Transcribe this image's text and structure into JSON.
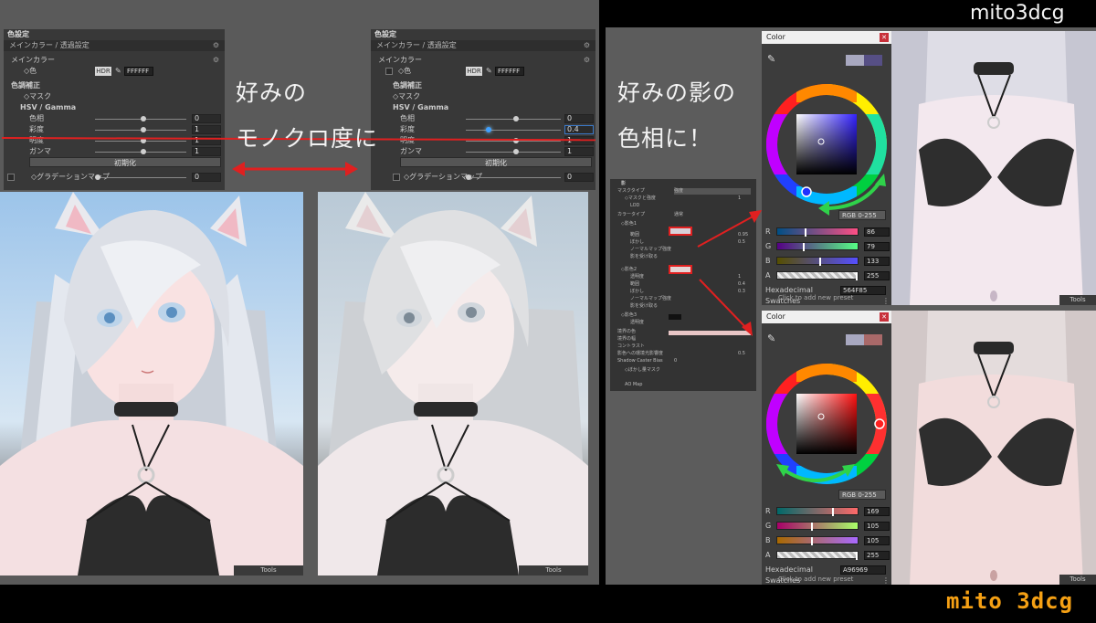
{
  "brand_top": "mito3dcg",
  "brand_bottom": "mito 3dcg",
  "captions": {
    "left_line1": "好みの",
    "left_line2": "モノクロ度に",
    "right_line1": "好みの影の",
    "right_line2": "色相に！"
  },
  "panel_left": {
    "section": "色設定",
    "subsection": "メインカラー / 透過設定",
    "group": "メインカラー",
    "color_label": "◇色",
    "hdr": "HDR",
    "hex": "FFFFFF",
    "correction": "色調補正",
    "mask": "◇マスク",
    "hsv": "HSV / Gamma",
    "hue_label": "色相",
    "hue": "0",
    "sat_label": "彩度",
    "sat": "1",
    "bright_label": "明度",
    "bright": "1",
    "gamma_label": "ガンマ",
    "gamma": "1",
    "reset": "初期化",
    "gradient": "◇グラデーションマップ",
    "gradient_val": "0"
  },
  "panel_mid": {
    "section": "色設定",
    "subsection": "メインカラー / 透過設定",
    "group": "メインカラー",
    "color_label": "◇色",
    "hdr": "HDR",
    "hex": "FFFFFF",
    "correction": "色調補正",
    "mask": "◇マスク",
    "hsv": "HSV / Gamma",
    "hue_label": "色相",
    "hue": "0",
    "sat_label": "彩度",
    "sat": "0.4",
    "bright_label": "明度",
    "bright": "1",
    "gamma_label": "ガンマ",
    "gamma": "1",
    "reset": "初期化",
    "gradient": "◇グラデーションマップ",
    "gradient_val": "0"
  },
  "tools_label": "Tools",
  "shadow_panel": {
    "title": "影",
    "rows": [
      "マスクタイプ",
      "◇マスクと強度",
      "LOD",
      "カラータイプ",
      "◇影色1",
      "範囲",
      "ぼかし",
      "ノーマルマップ強度",
      "影を受け取る",
      "◇影色2",
      "透明度",
      "範囲",
      "ぼかし",
      "ノーマルマップ強度",
      "影を受け取る",
      "◇影色3",
      "透明度",
      "境界の色",
      "境界の幅",
      "コントラスト",
      "影色への環境光影響度",
      "Shadow Caster Bias",
      "◇ぼかし量マスク",
      "AO Map"
    ],
    "mask_type_value": "強度",
    "color_type_value": "通常",
    "values": [
      "1",
      "0.95",
      "0.5",
      "1",
      "0.4",
      "0.3",
      "0.5",
      "0"
    ]
  },
  "picker1": {
    "title": "Color",
    "mode": "RGB 0-255",
    "r": "86",
    "g": "79",
    "b": "133",
    "a": "255",
    "hex_label": "Hexadecimal",
    "hex": "564F85",
    "swatches": "Swatches",
    "add_preset": "Click to add new preset",
    "color": "#564F85"
  },
  "picker2": {
    "title": "Color",
    "mode": "RGB 0-255",
    "r": "169",
    "g": "105",
    "b": "105",
    "a": "255",
    "hex_label": "Hexadecimal",
    "hex": "A96969",
    "swatches": "Swatches",
    "add_preset": "Click to add new preset",
    "color": "#A96969"
  },
  "labels": {
    "r": "R",
    "g": "G",
    "b": "B",
    "a": "A"
  },
  "colors": {
    "accent_red": "#e02020",
    "accent_green": "#2fd24a",
    "panel_bg": "#383838"
  }
}
